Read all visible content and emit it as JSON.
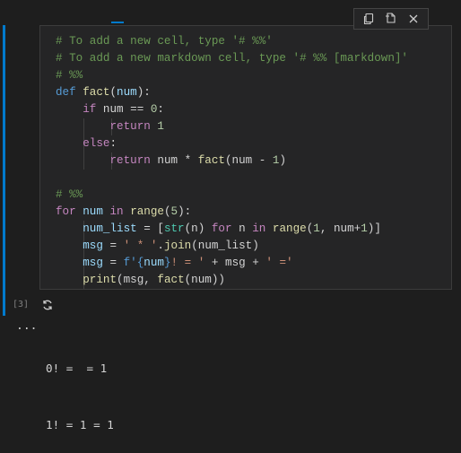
{
  "cell": {
    "code_lines": [
      [
        {
          "t": "# To add a new cell, type '# %%'",
          "c": "cm"
        }
      ],
      [
        {
          "t": "# To add a new markdown cell, type '# %% [markdown]'",
          "c": "cm"
        }
      ],
      [
        {
          "t": "# %%",
          "c": "cm"
        }
      ],
      [
        {
          "t": "def",
          "c": "kb"
        },
        {
          "t": " ",
          "c": "pn"
        },
        {
          "t": "fact",
          "c": "fn"
        },
        {
          "t": "(",
          "c": "pn"
        },
        {
          "t": "num",
          "c": "vr"
        },
        {
          "t": "):",
          "c": "pn"
        }
      ],
      [
        {
          "t": "    ",
          "c": "pn"
        },
        {
          "t": "if",
          "c": "kw"
        },
        {
          "t": " num == ",
          "c": "pn"
        },
        {
          "t": "0",
          "c": "nm"
        },
        {
          "t": ":",
          "c": "pn"
        }
      ],
      [
        {
          "t": "        ",
          "c": "pn"
        },
        {
          "t": "return",
          "c": "kw"
        },
        {
          "t": " ",
          "c": "pn"
        },
        {
          "t": "1",
          "c": "nm"
        }
      ],
      [
        {
          "t": "    ",
          "c": "pn"
        },
        {
          "t": "else",
          "c": "kw"
        },
        {
          "t": ":",
          "c": "pn"
        }
      ],
      [
        {
          "t": "        ",
          "c": "pn"
        },
        {
          "t": "return",
          "c": "kw"
        },
        {
          "t": " num * ",
          "c": "pn"
        },
        {
          "t": "fact",
          "c": "fn"
        },
        {
          "t": "(num - ",
          "c": "pn"
        },
        {
          "t": "1",
          "c": "nm"
        },
        {
          "t": ")",
          "c": "pn"
        }
      ],
      [],
      [
        {
          "t": "# %%",
          "c": "cm"
        }
      ],
      [
        {
          "t": "for",
          "c": "kw"
        },
        {
          "t": " ",
          "c": "pn"
        },
        {
          "t": "num",
          "c": "vr"
        },
        {
          "t": " ",
          "c": "pn"
        },
        {
          "t": "in",
          "c": "kw"
        },
        {
          "t": " ",
          "c": "pn"
        },
        {
          "t": "range",
          "c": "fn"
        },
        {
          "t": "(",
          "c": "pn"
        },
        {
          "t": "5",
          "c": "nm"
        },
        {
          "t": "):",
          "c": "pn"
        }
      ],
      [
        {
          "t": "    ",
          "c": "pn"
        },
        {
          "t": "num_list",
          "c": "vr"
        },
        {
          "t": " = [",
          "c": "pn"
        },
        {
          "t": "str",
          "c": "bi"
        },
        {
          "t": "(n) ",
          "c": "pn"
        },
        {
          "t": "for",
          "c": "kw"
        },
        {
          "t": " n ",
          "c": "pn"
        },
        {
          "t": "in",
          "c": "kw"
        },
        {
          "t": " ",
          "c": "pn"
        },
        {
          "t": "range",
          "c": "fn"
        },
        {
          "t": "(",
          "c": "pn"
        },
        {
          "t": "1",
          "c": "nm"
        },
        {
          "t": ", num+",
          "c": "pn"
        },
        {
          "t": "1",
          "c": "nm"
        },
        {
          "t": ")]",
          "c": "pn"
        }
      ],
      [
        {
          "t": "    ",
          "c": "pn"
        },
        {
          "t": "msg",
          "c": "vr"
        },
        {
          "t": " = ",
          "c": "pn"
        },
        {
          "t": "' * '",
          "c": "st"
        },
        {
          "t": ".",
          "c": "pn"
        },
        {
          "t": "join",
          "c": "fn"
        },
        {
          "t": "(num_list)",
          "c": "pn"
        }
      ],
      [
        {
          "t": "    ",
          "c": "pn"
        },
        {
          "t": "msg",
          "c": "vr"
        },
        {
          "t": " = ",
          "c": "pn"
        },
        {
          "t": "f'",
          "c": "kb"
        },
        {
          "t": "{",
          "c": "kb"
        },
        {
          "t": "num",
          "c": "vr"
        },
        {
          "t": "}",
          "c": "kb"
        },
        {
          "t": "! = '",
          "c": "st"
        },
        {
          "t": " + msg + ",
          "c": "pn"
        },
        {
          "t": "' ='",
          "c": "st"
        }
      ],
      [
        {
          "t": "    ",
          "c": "pn"
        },
        {
          "t": "print",
          "c": "fn"
        },
        {
          "t": "(msg, ",
          "c": "pn"
        },
        {
          "t": "fact",
          "c": "fn"
        },
        {
          "t": "(num))",
          "c": "pn"
        }
      ]
    ]
  },
  "toolbar": {
    "copy_icon": "copy-icon",
    "split_icon": "split-cell-icon",
    "close_icon": "close-icon"
  },
  "execution": {
    "count_label": "[3]",
    "status_icon": "running-spinner-icon",
    "more_label": "..."
  },
  "output": {
    "lines": [
      "0! =  = 1",
      "1! = 1 = 1"
    ]
  },
  "colors": {
    "accent": "#007acc",
    "background": "#1e1e1e",
    "cell_background": "#252526"
  }
}
